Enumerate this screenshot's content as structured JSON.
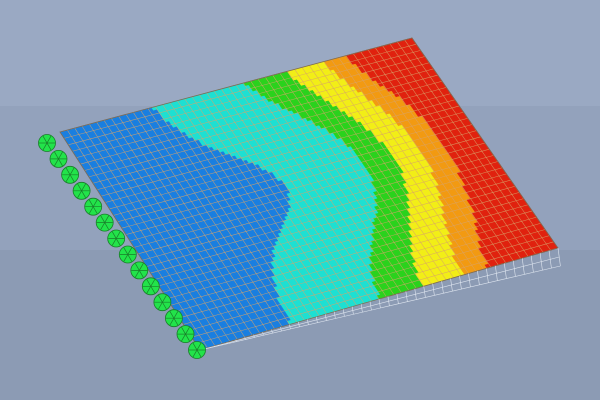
{
  "viewport": {
    "background_bands": [
      "#9aa9c3",
      "#93a2bc",
      "#8c9bb4"
    ],
    "mesh_line_color": "#d8a36a",
    "overhang_mesh_color": "#dfe6f0",
    "support_color": "#22e34a",
    "support_symbol_color": "#1a7d2a",
    "contour_palette": {
      "blue": "#1a7fe0",
      "cyan": "#1ee0d2",
      "green": "#2bd21d",
      "yellow": "#f2ee17",
      "orange": "#f29a12",
      "red": "#e0220f"
    },
    "mesh_divisions": {
      "u": 48,
      "v": 34
    },
    "support_count": 14,
    "fringe_levels": [
      0.18,
      0.3,
      0.42,
      0.54,
      0.66,
      0.78,
      0.88
    ]
  }
}
